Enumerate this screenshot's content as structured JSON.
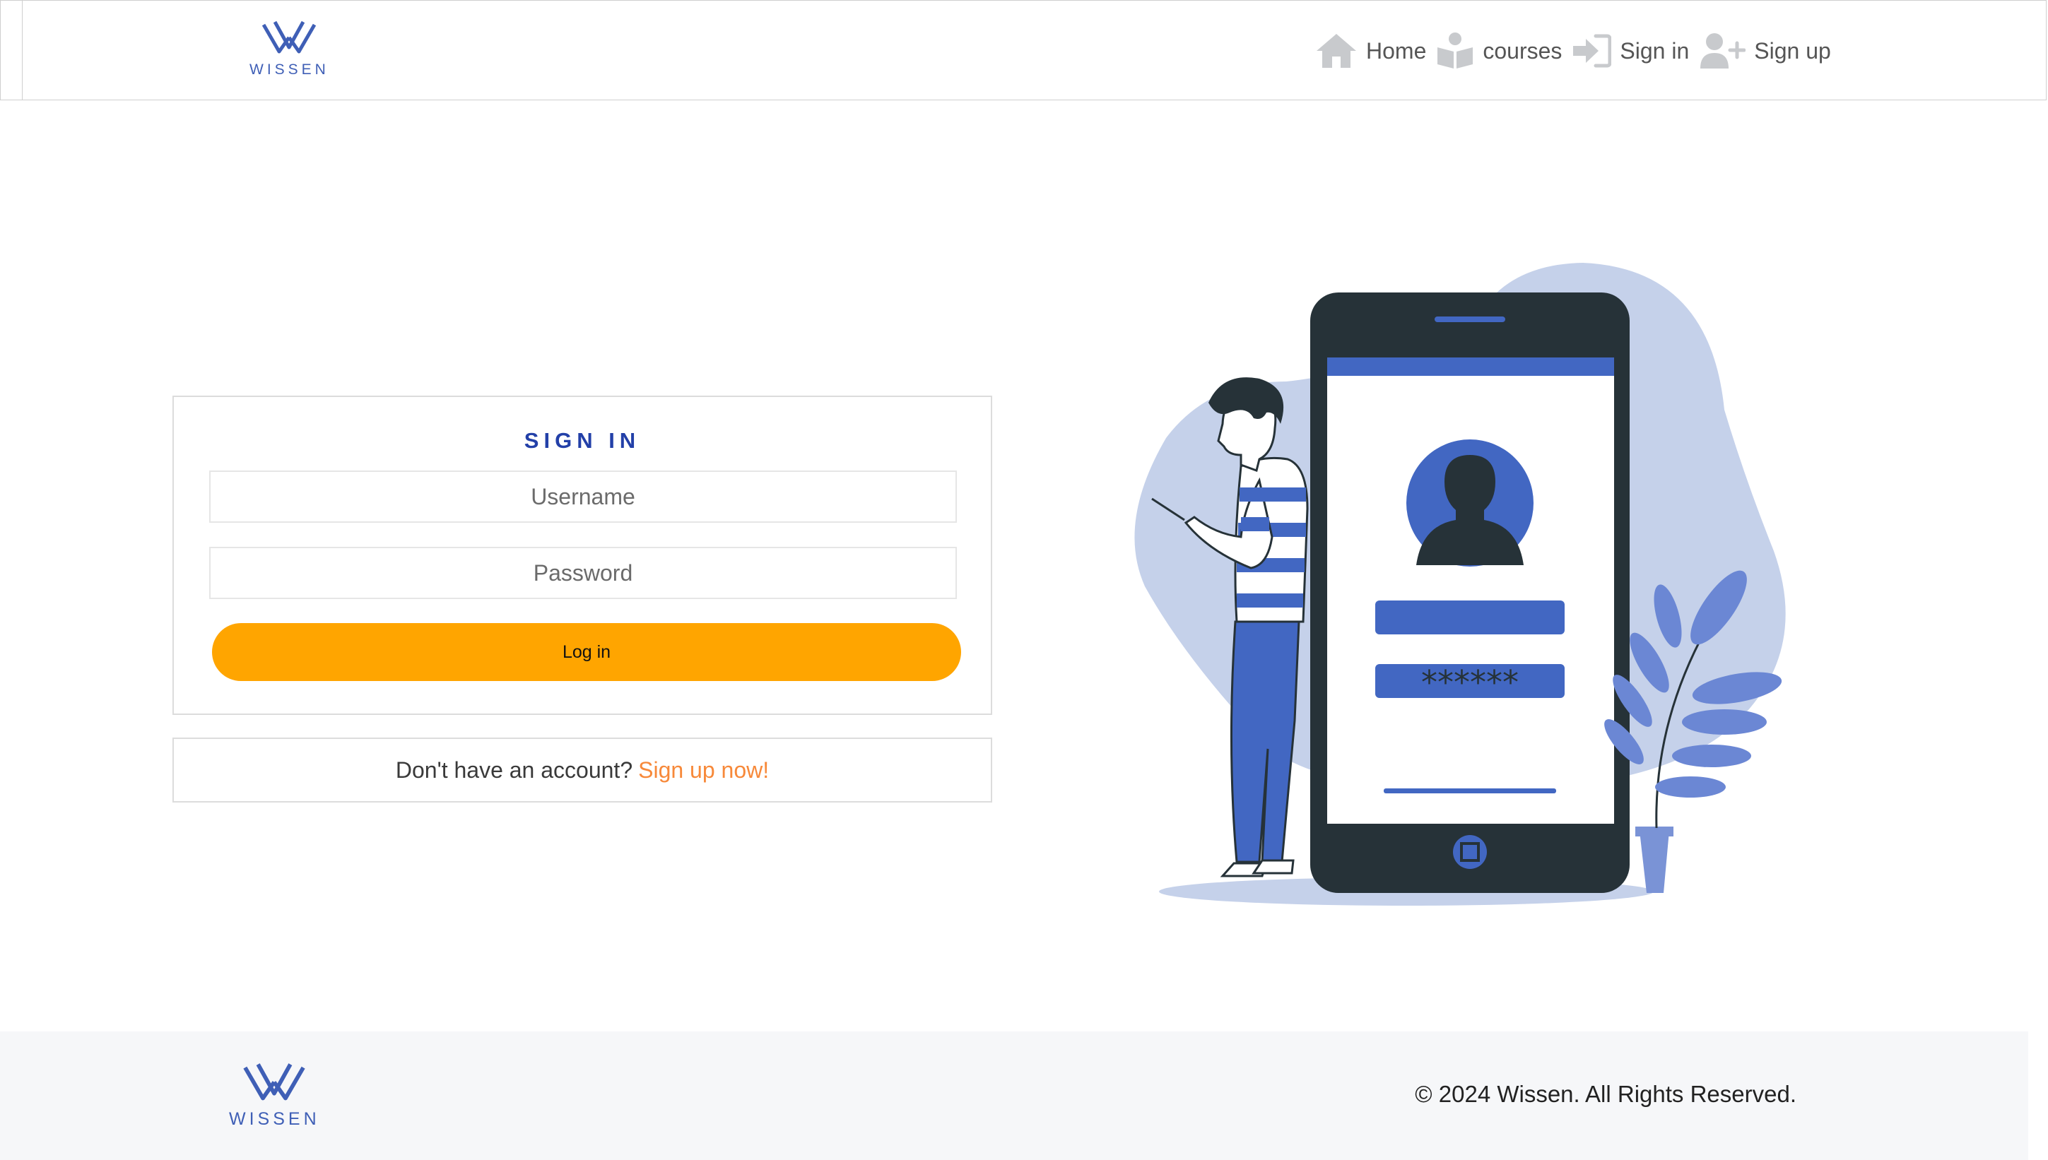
{
  "brand": {
    "name": "WISSEN",
    "color": "#3f5fb6"
  },
  "nav": {
    "items": [
      {
        "label": "Home",
        "icon": "home-icon"
      },
      {
        "label": "courses",
        "icon": "book-reader-icon"
      },
      {
        "label": "Sign in",
        "icon": "sign-in-icon"
      },
      {
        "label": "Sign up",
        "icon": "user-plus-icon"
      }
    ]
  },
  "signin": {
    "title": "SIGN IN",
    "username_placeholder": "Username",
    "password_placeholder": "Password",
    "login_label": "Log in",
    "signup_prompt": "Don't have an account?",
    "signup_link": "Sign up now!"
  },
  "illustration": {
    "password_mask": "******"
  },
  "footer": {
    "copyright": "© 2024 Wissen. All Rights Reserved."
  },
  "colors": {
    "accent_orange": "#ffa500",
    "link_orange": "#f7893a",
    "title_blue": "#2340a8",
    "illustration_blue": "#4267c2",
    "footer_bg": "#f6f7f9"
  }
}
